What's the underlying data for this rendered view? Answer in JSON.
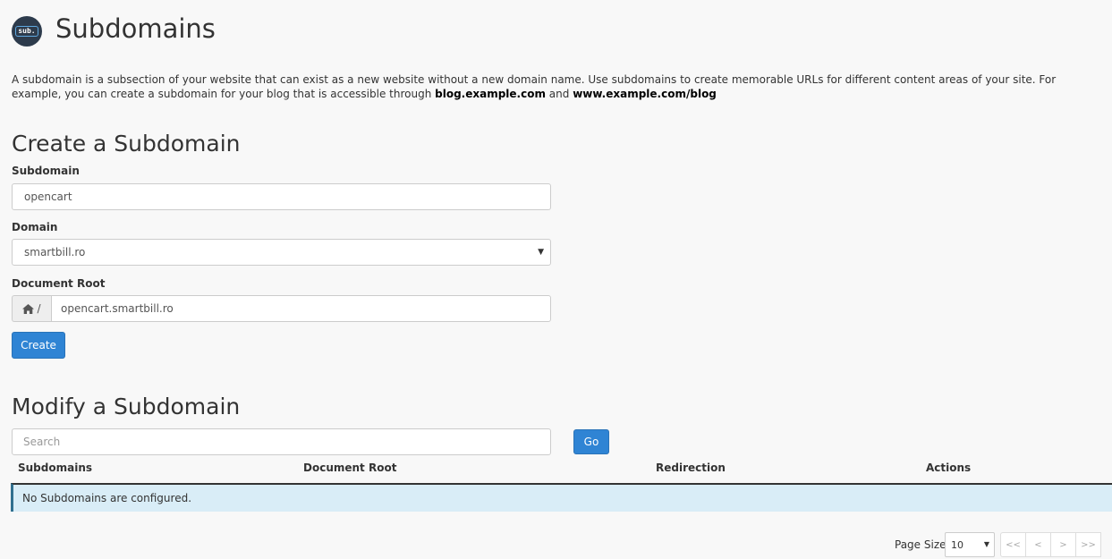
{
  "header": {
    "icon_text": "sub.",
    "title": "Subdomains"
  },
  "intro": {
    "text_before": "A subdomain is a subsection of your website that can exist as a new website without a new domain name. Use subdomains to create memorable URLs for different content areas of your site. For example, you can create a subdomain for your blog that is accessible through ",
    "example1": "blog.example.com",
    "and": " and ",
    "example2": "www.example.com/blog"
  },
  "create": {
    "heading": "Create a Subdomain",
    "subdomain_label": "Subdomain",
    "subdomain_value": "opencart",
    "domain_label": "Domain",
    "domain_value": "smartbill.ro",
    "docroot_label": "Document Root",
    "docroot_prefix": "/",
    "docroot_value": "opencart.smartbill.ro",
    "create_button": "Create"
  },
  "modify": {
    "heading": "Modify a Subdomain",
    "search_placeholder": "Search",
    "go_button": "Go",
    "columns": [
      "Subdomains",
      "Document Root",
      "Redirection",
      "Actions"
    ],
    "empty_message": "No Subdomains are configured."
  },
  "pager": {
    "page_size_label": "Page Size",
    "page_size_value": "10",
    "first": "<<",
    "prev": "<",
    "next": ">",
    "last": ">>"
  },
  "colors": {
    "primary": "#2f84d4",
    "info_row": "#d9edf7"
  }
}
